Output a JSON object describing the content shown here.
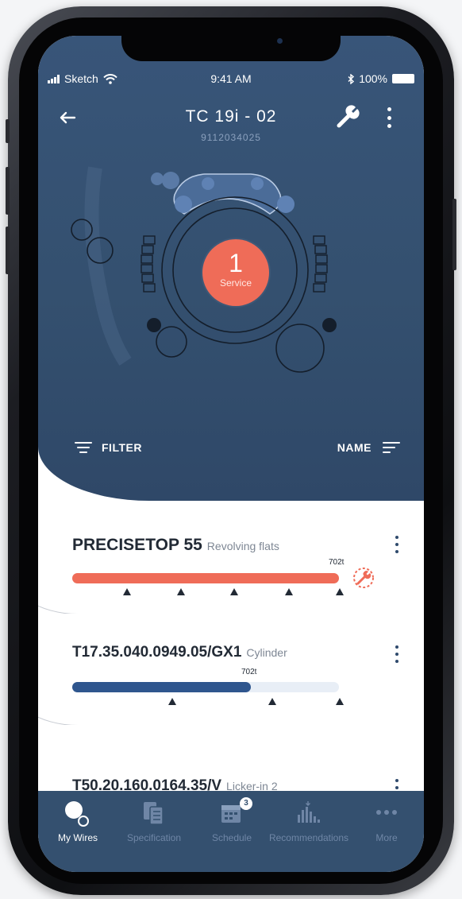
{
  "status_bar": {
    "carrier": "Sketch",
    "time": "9:41 AM",
    "battery": "100%"
  },
  "header": {
    "title": "TC 19i - 02",
    "serial": "9112034025"
  },
  "service_badge": {
    "count": "1",
    "label": "Service",
    "color": "#ef6c58"
  },
  "controls": {
    "filter_label": "FILTER",
    "sort_label": "NAME"
  },
  "wires": [
    {
      "name": "PRECISETOP 55",
      "category": "Revolving flats",
      "marker": "702t",
      "progress": 1.0,
      "status": "service-due",
      "bar_color": "#ef6c58"
    },
    {
      "name": "T17.35.040.0949.05/GX1",
      "category": "Cylinder",
      "marker": "702t",
      "progress": 0.67,
      "status": "ok",
      "bar_color": "#2f568e"
    },
    {
      "name": "T50.20.160.0164.35/V",
      "category": "Licker-in 2"
    }
  ],
  "tabs": [
    {
      "label": "My Wires",
      "icon": "wires-icon",
      "active": true
    },
    {
      "label": "Specification",
      "icon": "specification-icon",
      "active": false
    },
    {
      "label": "Schedule",
      "icon": "calendar-icon",
      "active": false,
      "badge": "3"
    },
    {
      "label": "Recommendations",
      "icon": "bar-chart-icon",
      "active": false
    },
    {
      "label": "More",
      "icon": "more-dots-icon",
      "active": false
    }
  ],
  "colors": {
    "header_bg": "#385579",
    "tab_bg": "#34506f",
    "accent_red": "#ef6c58",
    "accent_blue": "#2f568e"
  }
}
